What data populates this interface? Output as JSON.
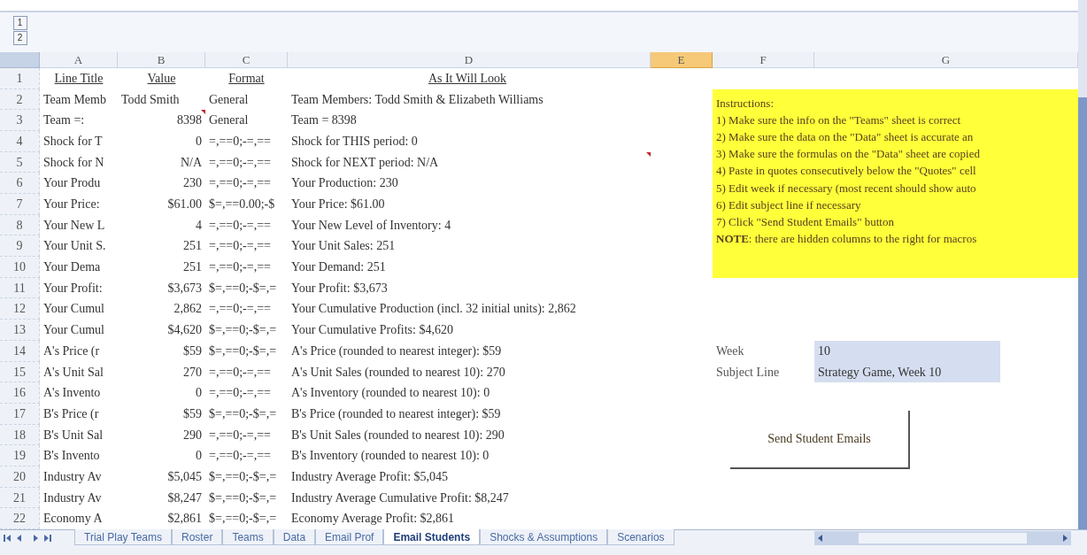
{
  "outline_levels": [
    "1",
    "2"
  ],
  "columns": [
    {
      "label": "A",
      "selected": false
    },
    {
      "label": "B",
      "selected": false
    },
    {
      "label": "C",
      "selected": false
    },
    {
      "label": "D",
      "selected": false
    },
    {
      "label": "E",
      "selected": true
    },
    {
      "label": "F",
      "selected": false
    },
    {
      "label": "G",
      "selected": false
    }
  ],
  "rows": [
    {
      "number": "1",
      "kind": "heading",
      "line_title": "Line Title",
      "value": "Value",
      "format": "Format",
      "as_it_will_look": "As It Will Look",
      "value_comment": false,
      "look_comment": false
    },
    {
      "number": "2",
      "kind": "text",
      "line_title": "Team Memb",
      "value": "Todd Smith",
      "format": "General",
      "as_it_will_look": "Team Members:  Todd Smith & Elizabeth Williams",
      "value_comment": false,
      "look_comment": false
    },
    {
      "number": "3",
      "kind": "number",
      "line_title": "Team =:",
      "value": "8398",
      "format": "General",
      "as_it_will_look": "Team =  8398",
      "value_comment": true,
      "look_comment": false
    },
    {
      "number": "4",
      "kind": "number",
      "line_title": "Shock for T",
      "value": "0",
      "format": "=,==0;-=,==",
      "as_it_will_look": "Shock for THIS period: 0",
      "value_comment": false,
      "look_comment": false
    },
    {
      "number": "5",
      "kind": "number",
      "line_title": "Shock for N",
      "value": "N/A",
      "format": "=,==0;-=,==",
      "as_it_will_look": "Shock for NEXT period: N/A",
      "value_comment": false,
      "look_comment": true
    },
    {
      "number": "6",
      "kind": "number",
      "line_title": "Your Produ",
      "value": "230",
      "format": "=,==0;-=,==",
      "as_it_will_look": "Your Production: 230",
      "value_comment": false,
      "look_comment": false
    },
    {
      "number": "7",
      "kind": "number",
      "line_title": "Your Price:",
      "value": "$61.00",
      "format": "$=,==0.00;-$",
      "as_it_will_look": "Your Price: $61.00",
      "value_comment": false,
      "look_comment": false
    },
    {
      "number": "8",
      "kind": "number",
      "line_title": "Your New L",
      "value": "4",
      "format": "=,==0;-=,==",
      "as_it_will_look": "Your New Level of Inventory: 4",
      "value_comment": false,
      "look_comment": false
    },
    {
      "number": "9",
      "kind": "number",
      "line_title": "Your Unit S.",
      "value": "251",
      "format": "=,==0;-=,==",
      "as_it_will_look": "Your Unit Sales: 251",
      "value_comment": false,
      "look_comment": false
    },
    {
      "number": "10",
      "kind": "number",
      "line_title": "Your Dema",
      "value": "251",
      "format": "=,==0;-=,==",
      "as_it_will_look": "Your Demand: 251",
      "value_comment": false,
      "look_comment": false
    },
    {
      "number": "11",
      "kind": "number",
      "line_title": "Your Profit:",
      "value": "$3,673",
      "format": "$=,==0;-$=,=",
      "as_it_will_look": "Your Profit: $3,673",
      "value_comment": false,
      "look_comment": false
    },
    {
      "number": "12",
      "kind": "number",
      "line_title": "Your Cumul",
      "value": "2,862",
      "format": "=,==0;-=,==",
      "as_it_will_look": "Your Cumulative Production (incl. 32 initial units): 2,862",
      "value_comment": false,
      "look_comment": false
    },
    {
      "number": "13",
      "kind": "number",
      "line_title": "Your Cumul",
      "value": "$4,620",
      "format": "$=,==0;-$=,=",
      "as_it_will_look": "Your Cumulative Profits: $4,620",
      "value_comment": false,
      "look_comment": false
    },
    {
      "number": "14",
      "kind": "number",
      "line_title": "A's Price (r",
      "value": "$59",
      "format": "$=,==0;-$=,=",
      "as_it_will_look": "A's Price (rounded to nearest integer): $59",
      "value_comment": false,
      "look_comment": false
    },
    {
      "number": "15",
      "kind": "number",
      "line_title": "A's Unit Sal",
      "value": "270",
      "format": "=,==0;-=,==",
      "as_it_will_look": "A's Unit Sales (rounded to nearest 10): 270",
      "value_comment": false,
      "look_comment": false
    },
    {
      "number": "16",
      "kind": "number",
      "line_title": "A's Invento",
      "value": "0",
      "format": "=,==0;-=,==",
      "as_it_will_look": "A's Inventory (rounded to nearest 10): 0",
      "value_comment": false,
      "look_comment": false
    },
    {
      "number": "17",
      "kind": "number",
      "line_title": "B's Price (r",
      "value": "$59",
      "format": "$=,==0;-$=,=",
      "as_it_will_look": "B's Price (rounded to nearest integer): $59",
      "value_comment": false,
      "look_comment": false
    },
    {
      "number": "18",
      "kind": "number",
      "line_title": "B's Unit Sal",
      "value": "290",
      "format": "=,==0;-=,==",
      "as_it_will_look": "B's Unit Sales (rounded to nearest 10): 290",
      "value_comment": false,
      "look_comment": false
    },
    {
      "number": "19",
      "kind": "number",
      "line_title": "B's Invento",
      "value": "0",
      "format": "=,==0;-=,==",
      "as_it_will_look": "B's Inventory (rounded to nearest 10): 0",
      "value_comment": false,
      "look_comment": false
    },
    {
      "number": "20",
      "kind": "number",
      "line_title": "Industry Av",
      "value": "$5,045",
      "format": "$=,==0;-$=,=",
      "as_it_will_look": "Industry Average Profit: $5,045",
      "value_comment": false,
      "look_comment": false
    },
    {
      "number": "21",
      "kind": "number",
      "line_title": "Industry Av",
      "value": "$8,247",
      "format": "$=,==0;-$=,=",
      "as_it_will_look": "Industry Average Cumulative Profit: $8,247",
      "value_comment": false,
      "look_comment": false
    },
    {
      "number": "22",
      "kind": "number",
      "line_title": "Economy A",
      "value": "$2,861",
      "format": "$=,==0;-$=,=",
      "as_it_will_look": "Economy Average Profit: $2,861",
      "value_comment": false,
      "look_comment": false
    }
  ],
  "instructions": {
    "title": "Instructions:",
    "lines": [
      "1) Make sure the info on the \"Teams\" sheet is correct",
      "2) Make sure the data on the \"Data\" sheet is accurate an",
      "3) Make sure the formulas on the \"Data\" sheet are copied",
      "4) Paste in quotes consecutively below the \"Quotes\" cell",
      "5) Edit week if necessary (most recent should show auto",
      "6) Edit subject line if necessary",
      "7) Click \"Send Student Emails\" button",
      "**NOTE**: there are hidden columns to the right for macros"
    ]
  },
  "settings": [
    {
      "label": "Week",
      "value": "10"
    },
    {
      "label": "Subject Line",
      "value": "Strategy Game, Week 10"
    }
  ],
  "button": "Send Student Emails",
  "sheet_tabs": [
    {
      "label": "Trial Play Teams",
      "selected": false
    },
    {
      "label": "Roster",
      "selected": false
    },
    {
      "label": "Teams",
      "selected": false
    },
    {
      "label": "Data",
      "selected": false
    },
    {
      "label": "Email Prof",
      "selected": false
    },
    {
      "label": "Email Students",
      "selected": true
    },
    {
      "label": "Shocks & Assumptions",
      "selected": false
    },
    {
      "label": "Scenarios",
      "selected": false
    }
  ]
}
